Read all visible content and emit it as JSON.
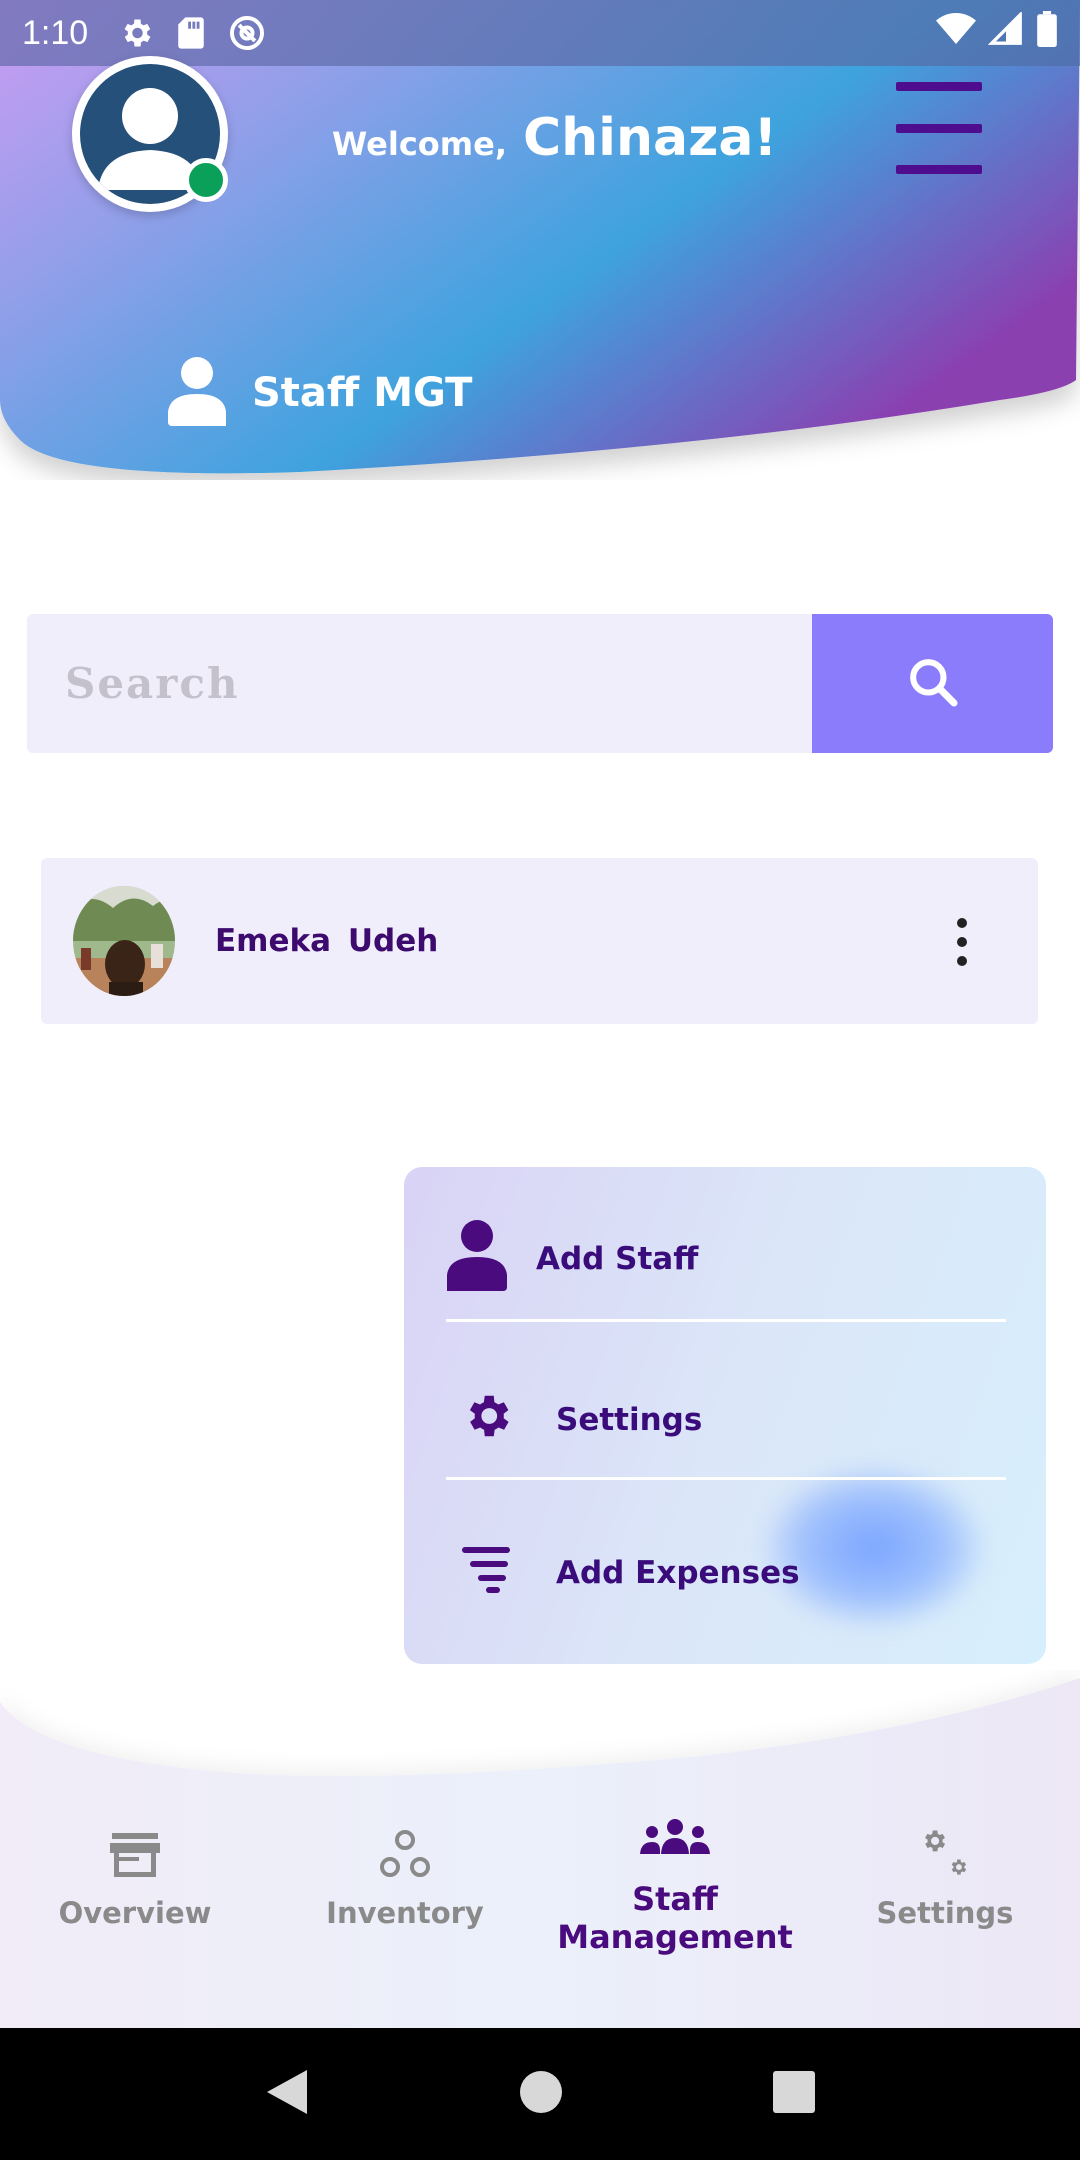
{
  "status_bar": {
    "time": "1:10",
    "icons": [
      "gear-icon",
      "sd-card-icon",
      "at-sign-icon",
      "wifi-icon",
      "signal-icon",
      "battery-icon"
    ]
  },
  "header": {
    "welcome_prefix": "Welcome,",
    "user_name": "Chinaza!",
    "section_title": "Staff MGT",
    "online_status_color": "#0aa05a",
    "gradient_colors": [
      "#c9a0f0",
      "#6f9be6",
      "#3aa2e0",
      "#8a49b5"
    ]
  },
  "search": {
    "placeholder": "Search",
    "button_color": "#8b7cfc"
  },
  "staff": [
    {
      "name": "Emeka  Udeh"
    }
  ],
  "popup_menu": {
    "items": [
      {
        "label": "Add Staff",
        "icon": "person-icon"
      },
      {
        "label": "Settings",
        "icon": "gear-icon"
      },
      {
        "label": "Add Expenses",
        "icon": "filter-lines-icon"
      }
    ]
  },
  "bottom_nav": {
    "tabs": [
      {
        "label": "Overview",
        "icon": "store-icon",
        "active": false
      },
      {
        "label": "Inventory",
        "icon": "circles-icon",
        "active": false
      },
      {
        "label_line1": "Staff",
        "label_line2": "Management",
        "icon": "group-icon",
        "active": true
      },
      {
        "label": "Settings",
        "icon": "gears-icon",
        "active": false
      }
    ],
    "active_color": "#4a0b7e",
    "inactive_color": "#8a8a8a"
  },
  "system_nav": {
    "buttons": [
      "back-icon",
      "home-icon",
      "recents-icon"
    ]
  }
}
